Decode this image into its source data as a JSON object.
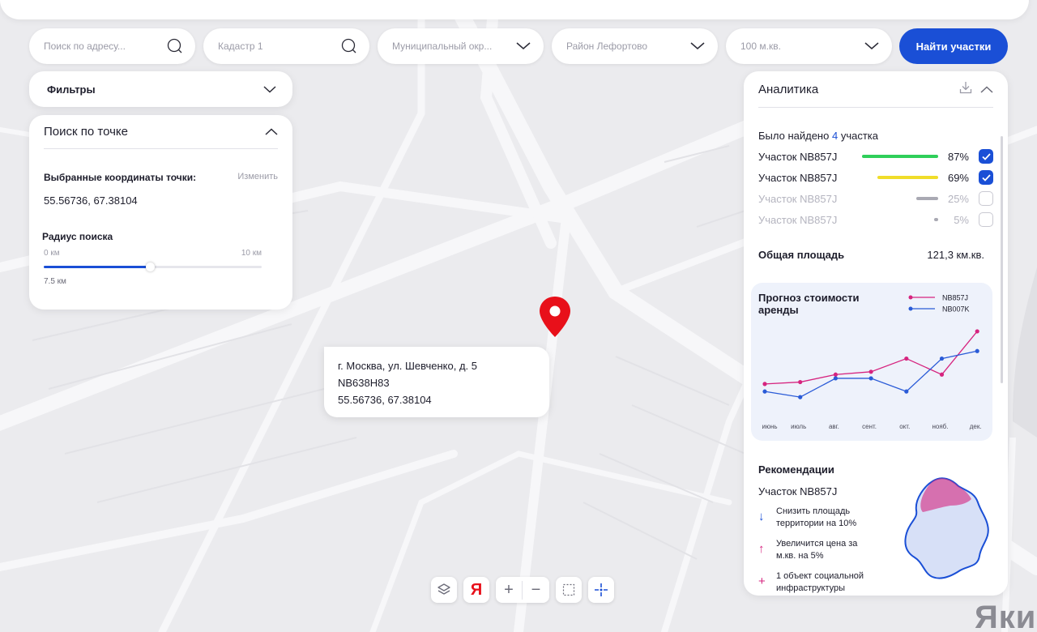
{
  "search": {
    "address_placeholder": "Поиск по адресу...",
    "cadastre_placeholder": "Кадастр 1",
    "municipality": "Муниципальный окр...",
    "district": "Район Лефортово",
    "area": "100 м.кв.",
    "find_button": "Найти участки"
  },
  "filters": {
    "label": "Фильтры"
  },
  "point_search": {
    "title": "Поиск по точке",
    "coords_label": "Выбранные координаты точки:",
    "edit_label": "Изменить",
    "coords_value": "55.56736, 67.38104",
    "radius_label": "Радиус поиска",
    "range_min": "0 км",
    "range_max": "10 км",
    "radius_value": "7.5 км",
    "radius_fraction": 0.75
  },
  "popup": {
    "address": "г. Москва, ул. Шевченко, д. 5",
    "id": "NB638H83",
    "coords": "55.56736, 67.38104"
  },
  "analytics": {
    "title": "Аналитика",
    "found_prefix": "Было найдено ",
    "found_count": "4",
    "found_suffix": " участка",
    "plots": [
      {
        "name": "Участок NB857J",
        "percent": "87%",
        "value": 0.87,
        "color": "#2fcf5a",
        "checked": true
      },
      {
        "name": "Участок NB857J",
        "percent": "69%",
        "value": 0.69,
        "color": "#f0dd2a",
        "checked": true
      },
      {
        "name": "Участок NB857J",
        "percent": "25%",
        "value": 0.25,
        "color": "#a9a9b3",
        "checked": false
      },
      {
        "name": "Участок NB857J",
        "percent": "5%",
        "value": 0.05,
        "color": "#a9a9b3",
        "checked": false
      }
    ],
    "total_label": "Общая площадь",
    "total_value": "121,3 км.кв."
  },
  "chart_data": {
    "type": "line",
    "title": "Прогноз стоимости аренды",
    "categories": [
      "июнь",
      "июль",
      "авг.",
      "сент.",
      "окт.",
      "нояб.",
      "дек."
    ],
    "series": [
      {
        "name": "NB857J",
        "color": "#d6247f",
        "values": [
          3.2,
          3.4,
          4.2,
          4.5,
          5.9,
          4.2,
          8.8
        ]
      },
      {
        "name": "NB007K",
        "color": "#2a5bd7",
        "values": [
          2.4,
          1.8,
          3.8,
          3.8,
          2.4,
          5.9,
          6.7
        ]
      }
    ],
    "ylim": [
      0,
      10
    ]
  },
  "recommendations": {
    "title": "Рекомендации",
    "plot": "Участок NB857J",
    "items": [
      {
        "icon": "arrow-down-icon",
        "text": "Снизить площадь территории на 10%",
        "color": "#1a4fd6"
      },
      {
        "icon": "arrow-up-icon",
        "text": "Увеличится цена за м.кв. на 5%",
        "color": "#d6247f"
      },
      {
        "icon": "plus-icon",
        "text": "1 объект социальной инфраструктуры",
        "color": "#d6247f"
      }
    ]
  },
  "map": {
    "provider_logo": "Яки",
    "yandex_letter": "Я"
  },
  "colors": {
    "accent": "#1a4fd6",
    "pin": "#e8101a",
    "magenta": "#d6247f"
  }
}
